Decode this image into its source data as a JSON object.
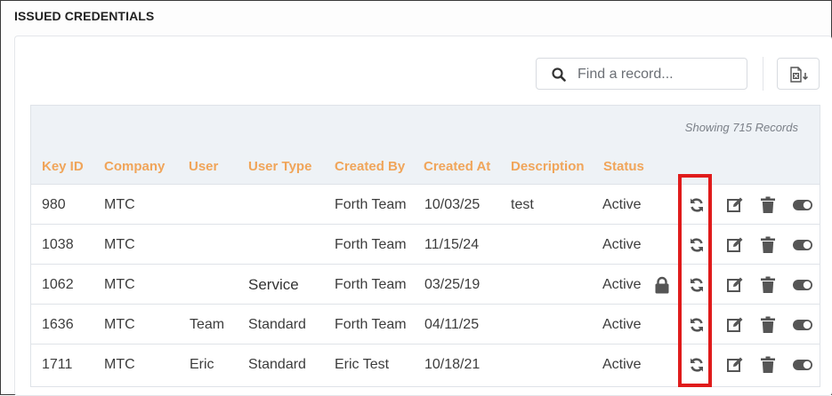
{
  "section": {
    "title": "ISSUED CREDENTIALS"
  },
  "search": {
    "placeholder": "Find a record...",
    "icon": "search-icon"
  },
  "export": {
    "icon": "excel-export-icon"
  },
  "table": {
    "records_text": "Showing 715 Records",
    "columns": [
      "Key ID",
      "Company",
      "User",
      "User Type",
      "Created By",
      "Created At",
      "Description",
      "Status"
    ],
    "rows": [
      {
        "key_id": "980",
        "company": "MTC",
        "user": "",
        "user_type": "",
        "created_by": "Forth Team",
        "created_at": "10/03/25",
        "description": "test",
        "status": "Active",
        "locked": false
      },
      {
        "key_id": "1038",
        "company": "MTC",
        "user": "",
        "user_type": "",
        "created_by": "Forth Team",
        "created_at": "11/15/24",
        "description": "",
        "status": "Active",
        "locked": false
      },
      {
        "key_id": "1062",
        "company": "MTC",
        "user": "",
        "user_type": "Service",
        "created_by": "Forth Team",
        "created_at": "03/25/19",
        "description": "",
        "status": "Active",
        "locked": true
      },
      {
        "key_id": "1636",
        "company": "MTC",
        "user": "Team",
        "user_type": "Standard",
        "created_by": "Forth Team",
        "created_at": "04/11/25",
        "description": "",
        "status": "Active",
        "locked": false
      },
      {
        "key_id": "1711",
        "company": "MTC",
        "user": "Eric",
        "user_type": "Standard",
        "created_by": "Eric Test",
        "created_at": "10/18/21",
        "description": "",
        "status": "Active",
        "locked": false
      }
    ]
  },
  "row_actions": [
    "refresh-icon",
    "edit-icon",
    "trash-icon",
    "toggle-icon"
  ],
  "colors": {
    "header_text": "#f0a55a",
    "highlight": "#e01b1b",
    "icon": "#555555"
  }
}
